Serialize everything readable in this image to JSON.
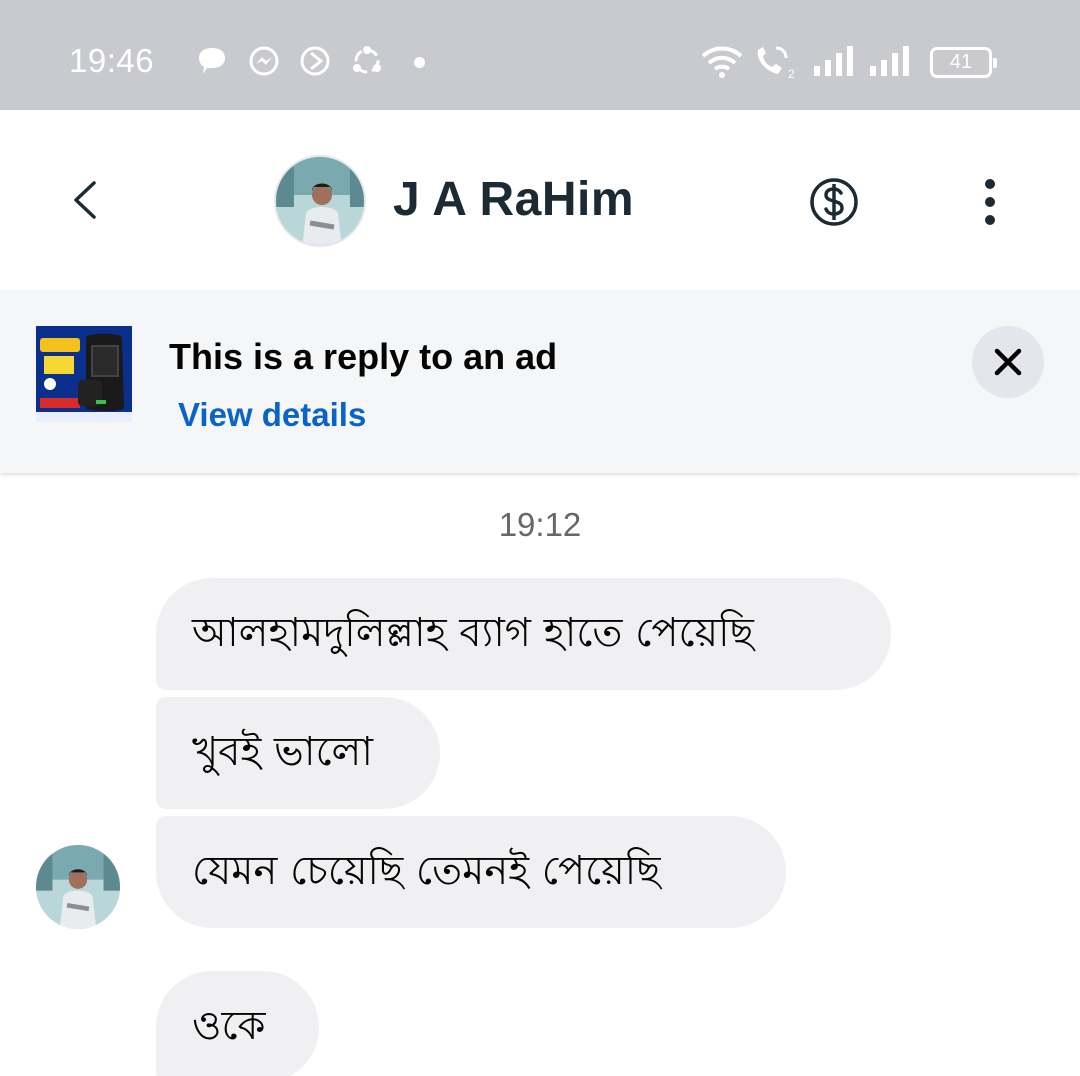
{
  "status_bar": {
    "time": "19:46",
    "battery": "41",
    "notification_icons": [
      "chat-bubble-icon",
      "messenger-icon",
      "play-icon",
      "sync-icon"
    ],
    "system_icons": [
      "wifi-icon",
      "wifi-call-icon",
      "signal-icon",
      "signal-icon",
      "battery-icon"
    ]
  },
  "header": {
    "contact_name": "J A RaHim",
    "icons": [
      "back-icon",
      "dollar-icon",
      "more-vertical-icon"
    ]
  },
  "ad_banner": {
    "title": "This is a reply to an ad",
    "link_text": "View details",
    "link_color": "#0a64c8",
    "close_icon": "close-icon"
  },
  "conversation": {
    "timestamp": "19:12",
    "messages": [
      {
        "text": "আলহামদুলিল্লাহ ব্যাগ হাতে পেয়েছি"
      },
      {
        "text": "খুবই ভালো"
      },
      {
        "text": "যেমন চেয়েছি তেমনই পেয়েছি"
      },
      {
        "text": "ওকে"
      }
    ]
  },
  "colors": {
    "status_bar_bg": "#c9cacf",
    "bubble_bg": "#f0f0f2",
    "banner_bg": "#f5f6f7"
  }
}
